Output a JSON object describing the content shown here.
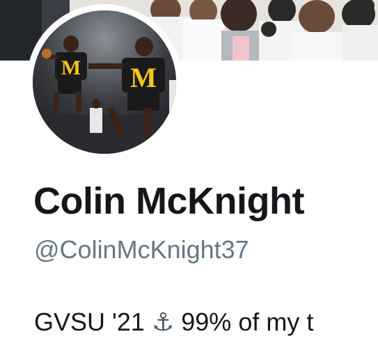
{
  "profile": {
    "display_name": "Colin McKnight",
    "handle": "@ColinMcKnight37",
    "bio_start": "GVSU '21",
    "bio_emoji": "⚓",
    "bio_rest": "99% of my t"
  },
  "avatar": {
    "jersey_letter": "M"
  },
  "colors": {
    "name": "#14171a",
    "handle": "#657786",
    "jersey_maize": "#f5c518",
    "jersey_dark": "#1a1a1a"
  }
}
